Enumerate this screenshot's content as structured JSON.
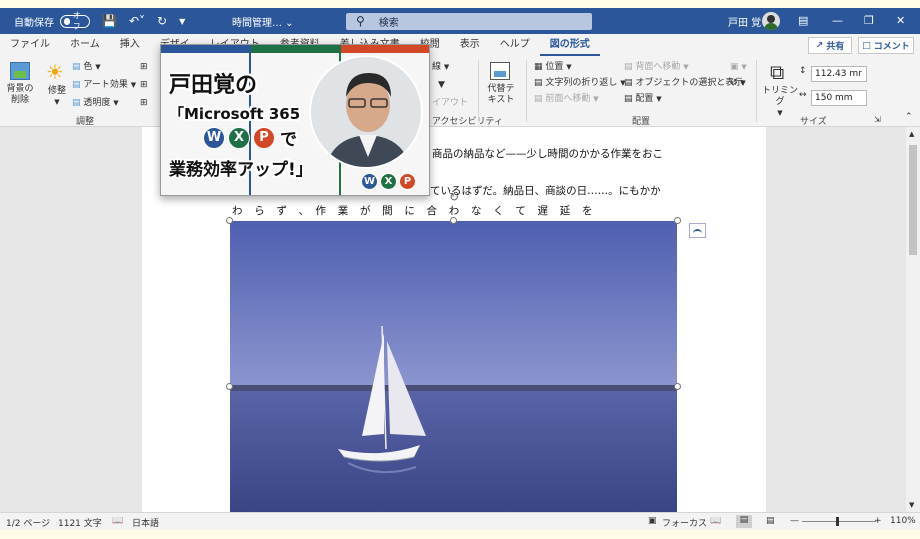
{
  "titlebar": {
    "autosave_label": "自動保存",
    "autosave_state": "オフ",
    "doc_title": "時間管理… ⌄",
    "search_placeholder": "検索",
    "user_name": "戸田 覚"
  },
  "tabs": [
    "ファイル",
    "ホーム",
    "挿入",
    "デザイ",
    "レイアウト",
    "参考資料",
    "差し込み文書",
    "校閲",
    "表示",
    "ヘルプ",
    "図の形式"
  ],
  "active_tab": "図の形式",
  "share_label": "共有",
  "comment_label": "コメント",
  "ribbon": {
    "remove_bg": "背景の\n削除",
    "corrections": "修整",
    "color": "色",
    "artistic": "アート効果",
    "transparency": "透明度",
    "adjust_group": "調整",
    "accessibility_group": "アクセシビリティ",
    "alt_text": "代替テ\nキスト",
    "position": "位置",
    "wrap_text": "文字列の折り返し",
    "bring_forward": "前面へ移動",
    "send_backward": "背面へ移動",
    "selection_pane": "オブジェクトの選択と表示",
    "align": "配置",
    "arrange_group": "配置",
    "crop": "トリミング",
    "height": "112.43 mr",
    "width": "150 mm",
    "size_group": "サイズ",
    "border_partial": "線",
    "layout_partial": "イアウト"
  },
  "document": {
    "line1": "商品の納品など——少し時間のかかる作業をおこ",
    "line2": "ているはずだ。納品日、商談の日……。にもかか",
    "line3": "わ　ら　ず　、　作　業　が　間　に　合　わ　な　く　て　遅　延　を"
  },
  "banner": {
    "line1": "戸田覚の",
    "line2": "「Microsoft 365",
    "logo_w": "W",
    "logo_x": "X",
    "logo_p": "P",
    "line3_suffix": "で",
    "line4": "業務効率アップ!」"
  },
  "status": {
    "page": "1/2 ページ",
    "words": "1121 文字",
    "language": "日本語",
    "focus": "フォーカス",
    "zoom": "110%"
  },
  "colors": {
    "word_blue": "#2b579a",
    "excel_green": "#1e7145",
    "ppt_orange": "#d24726"
  }
}
